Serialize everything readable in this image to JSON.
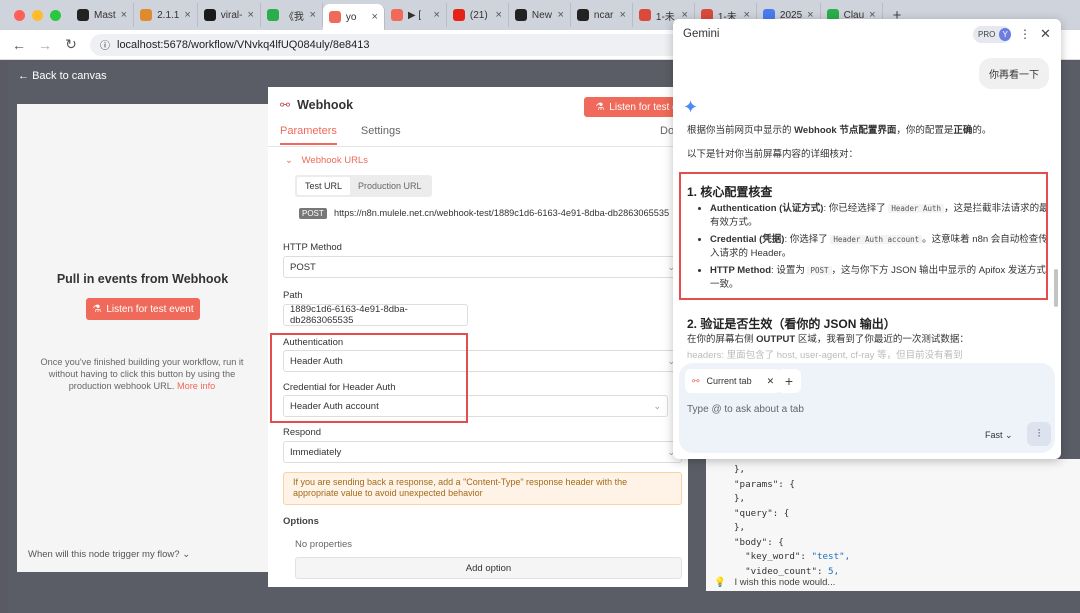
{
  "browser": {
    "tabs": [
      {
        "label": "Mast",
        "color": "#222"
      },
      {
        "label": "2.1.1",
        "color": "#e08a2e"
      },
      {
        "label": "viral-",
        "color": "#1a1a1a"
      },
      {
        "label": "《我",
        "color": "#2aae4a"
      },
      {
        "label": "yo",
        "color": "#ef6a5a",
        "active": true
      },
      {
        "label": "▶ [",
        "color": "#ef6a5a"
      },
      {
        "label": "(21)",
        "color": "#e62117"
      },
      {
        "label": "New",
        "color": "#222"
      },
      {
        "label": "ncar",
        "color": "#222"
      },
      {
        "label": "1-未",
        "color": "#d94a3a"
      },
      {
        "label": "1-未",
        "color": "#d94a3a"
      },
      {
        "label": "2025",
        "color": "#4a7cf0"
      },
      {
        "label": "Clau",
        "color": "#2aae4a"
      }
    ],
    "url": "localhost:5678/workflow/VNvkq4lfUQ084uly/8e8413"
  },
  "canvas": {
    "back_label": "Back to canvas",
    "pull_title": "Pull in events from Webhook",
    "listen_button": "Listen for test event",
    "description": "Once you've finished building your workflow, run it without having to click this button by using the production webhook URL.",
    "more_info": "More info",
    "trigger_question": "When will this node trigger my flow?"
  },
  "ndv": {
    "title": "Webhook",
    "listen_button": "Listen for test ev",
    "tabs": {
      "parameters": "Parameters",
      "settings": "Settings",
      "docs": "Do"
    },
    "webhook_urls_label": "Webhook URLs",
    "test_url_tab": "Test URL",
    "production_url_tab": "Production URL",
    "method_badge": "POST",
    "test_url": "https://n8n.mulele.net.cn/webhook-test/1889c1d6-6163-4e91-8dba-db2863065535",
    "http_method_label": "HTTP Method",
    "http_method_value": "POST",
    "path_label": "Path",
    "path_value": "1889c1d6-6163-4e91-8dba-db2863065535",
    "auth_label": "Authentication",
    "auth_value": "Header Auth",
    "credential_label": "Credential for Header Auth",
    "credential_value": "Header Auth account",
    "respond_label": "Respond",
    "respond_value": "Immediately",
    "notice": "If you are sending back a response, add a \"Content-Type\" response header with the appropriate value to avoid unexpected behavior",
    "options_label": "Options",
    "no_properties": "No properties",
    "add_option": "Add option"
  },
  "gemini": {
    "title": "Gemini",
    "pro_label": "PRO",
    "avatar": "Y",
    "user_message": "你再看一下",
    "intro_pre": "根据你当前网页中显示的 ",
    "intro_bold1": "Webhook 节点配置界面",
    "intro_mid": "，你的配置是",
    "intro_bold2": "正确",
    "intro_post": "的。",
    "intro2": "以下是针对你当前屏幕内容的详细核对：",
    "section1_title": "1. 核心配置核查",
    "items": [
      {
        "bold": "Authentication (认证方式)",
        "pre": ": 你已经选择了 ",
        "code": "Header Auth",
        "post": "，这是拦截非法请求的最有效方式。"
      },
      {
        "bold": "Credential (凭据)",
        "pre": ": 你选择了 ",
        "code": "Header Auth account",
        "post": "。这意味着 n8n 会自动检查传入请求的 Header。"
      },
      {
        "bold": "HTTP Method",
        "pre": ": 设置为 ",
        "code": "POST",
        "post": "，这与你下方 JSON 输出中显示的 Apifox 发送方式一致。"
      }
    ],
    "section2_title": "2. 验证是否生效（看你的 JSON 输出）",
    "section2_pre": "在你的屏幕右侧 ",
    "section2_bold": "OUTPUT",
    "section2_post": " 区域，我看到了你最近的一次测试数据：",
    "section2_cut": "headers: 里面包含了 host, user-agent, cf-ray 等，但目前没有看到",
    "current_tab": "Current tab",
    "input_placeholder": "Type @ to ask about a tab",
    "mode": "Fast"
  },
  "output": {
    "lines": [
      "},",
      "\"params\": {",
      "},",
      "\"query\": {",
      "},",
      "\"body\": {",
      "  \"key_word\": ",
      "  \"video_count\": "
    ],
    "key_word_value": "\"test\",",
    "video_count_value": "5,",
    "feedback": "I wish this node would..."
  },
  "colors": {
    "accent": "#ef6a5a",
    "highlight": "#e24d4d",
    "gemini_blue": "#4a8bf5"
  }
}
